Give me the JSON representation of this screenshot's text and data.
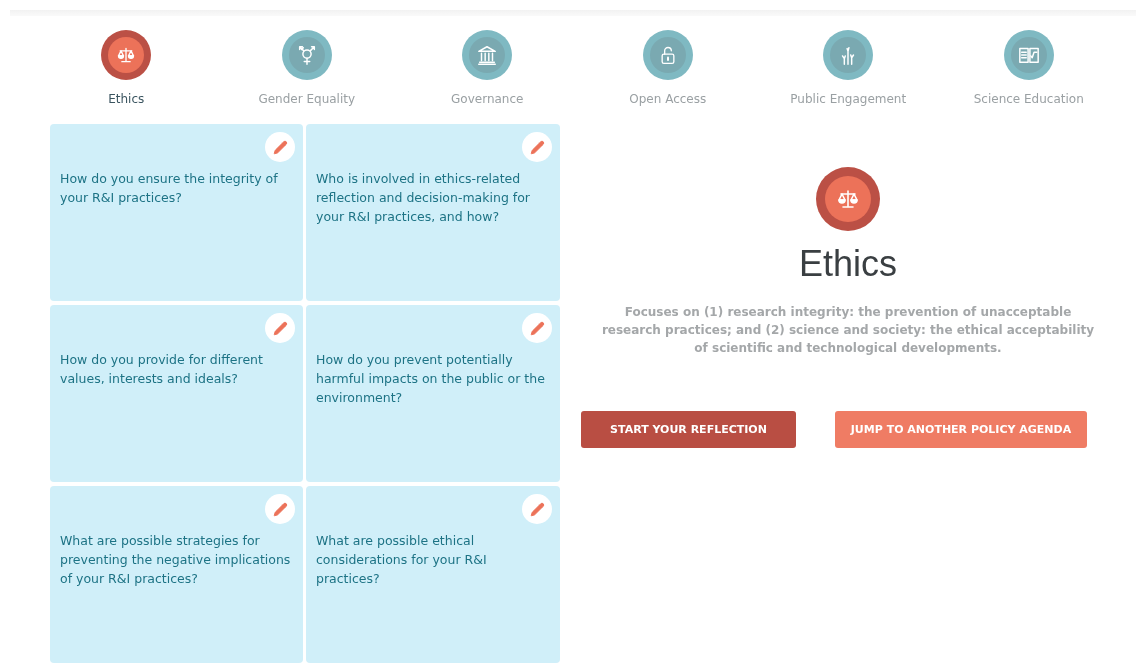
{
  "tabs": [
    {
      "label": "Ethics",
      "selected": true
    },
    {
      "label": "Gender Equality",
      "selected": false
    },
    {
      "label": "Governance",
      "selected": false
    },
    {
      "label": "Open Access",
      "selected": false
    },
    {
      "label": "Public Engagement",
      "selected": false
    },
    {
      "label": "Science Education",
      "selected": false
    }
  ],
  "questions": [
    {
      "text": "How do you ensure the integrity of your R&I practices?"
    },
    {
      "text": "Who is involved in ethics-related reflection and decision-making for your R&I practices, and how?"
    },
    {
      "text": "How do you provide for different values, interests and ideals?"
    },
    {
      "text": "How do you prevent potentially harmful impacts on the public or the environment?"
    },
    {
      "text": "What are possible strategies for preventing the negative implications of your R&I practices?"
    },
    {
      "text": "What are possible ethical considerations for your R&I practices?"
    }
  ],
  "detail": {
    "title": "Ethics",
    "description": "Focuses on (1) research integrity: the prevention of unacceptable research practices; and (2) science and society: the ethical acceptability of scientific and technological developments.",
    "buttons": [
      {
        "label": "START YOUR REFLECTION",
        "kind": "primary"
      },
      {
        "label": "JUMP TO ANOTHER POLICY AGENDA",
        "kind": "secondary"
      }
    ]
  }
}
